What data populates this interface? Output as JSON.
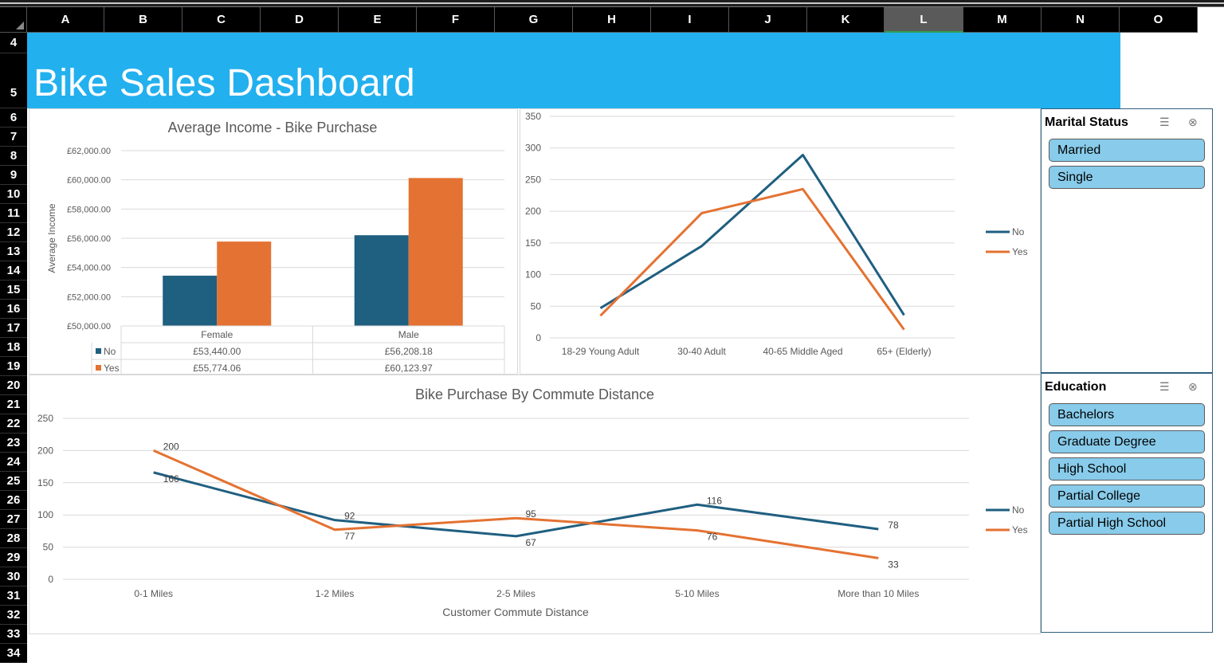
{
  "sheet": {
    "columns": [
      "A",
      "B",
      "C",
      "D",
      "E",
      "F",
      "G",
      "H",
      "I",
      "J",
      "K",
      "L",
      "M",
      "N",
      "O"
    ],
    "selected_column": "L",
    "rows": [
      "4",
      "5",
      "6",
      "7",
      "8",
      "9",
      "10",
      "11",
      "12",
      "13",
      "14",
      "15",
      "16",
      "17",
      "18",
      "19",
      "20",
      "21",
      "22",
      "23",
      "24",
      "25",
      "26",
      "27",
      "28",
      "29",
      "30",
      "31",
      "32",
      "33",
      "34"
    ]
  },
  "dashboard": {
    "title": "Bike Sales Dashboard"
  },
  "slicers": {
    "marital": {
      "title": "Marital Status",
      "items": [
        "Married",
        "Single"
      ]
    },
    "education": {
      "title": "Education",
      "items": [
        "Bachelors",
        "Graduate Degree",
        "High School",
        "Partial College",
        "Partial High School"
      ]
    }
  },
  "colors": {
    "no": "#1f5f80",
    "yes": "#e47232",
    "banner": "#23b0ee",
    "slicer_item": "#88cbea"
  },
  "chart_data": [
    {
      "type": "bar",
      "title": "Average Income - Bike Purchase",
      "ylabel": "Average Income",
      "categories": [
        "Female",
        "Male"
      ],
      "series": [
        {
          "name": "No",
          "values": [
            53440.0,
            56208.18
          ]
        },
        {
          "name": "Yes",
          "values": [
            55774.06,
            60123.97
          ]
        }
      ],
      "yticks": [
        "£50,000.00",
        "£52,000.00",
        "£54,000.00",
        "£56,000.00",
        "£58,000.00",
        "£60,000.00",
        "£62,000.00"
      ],
      "ylim": [
        50000,
        62000
      ],
      "data_table": {
        "No": [
          "£53,440.00",
          "£56,208.18"
        ],
        "Yes": [
          "£55,774.06",
          "£60,123.97"
        ]
      }
    },
    {
      "type": "line",
      "categories": [
        "18-29 Young Adult",
        "30-40 Adult",
        "40-65 Middle Aged",
        "65+ (Elderly)"
      ],
      "series": [
        {
          "name": "No",
          "values": [
            47,
            145,
            289,
            36
          ]
        },
        {
          "name": "Yes",
          "values": [
            35,
            197,
            235,
            13
          ]
        }
      ],
      "yticks": [
        "0",
        "50",
        "100",
        "150",
        "200",
        "250",
        "300",
        "350"
      ],
      "ylim": [
        0,
        350
      ],
      "legend": "right"
    },
    {
      "type": "line",
      "title": "Bike Purchase By Commute Distance",
      "xlabel": "Customer Commute Distance",
      "categories": [
        "0-1 Miles",
        "1-2 Miles",
        "2-5 Miles",
        "5-10 Miles",
        "More than 10 Miles"
      ],
      "series": [
        {
          "name": "No",
          "values": [
            166,
            92,
            67,
            116,
            78
          ]
        },
        {
          "name": "Yes",
          "values": [
            200,
            77,
            95,
            76,
            33
          ]
        }
      ],
      "yticks": [
        "0",
        "50",
        "100",
        "150",
        "200",
        "250"
      ],
      "ylim": [
        0,
        250
      ],
      "legend": "right"
    }
  ]
}
